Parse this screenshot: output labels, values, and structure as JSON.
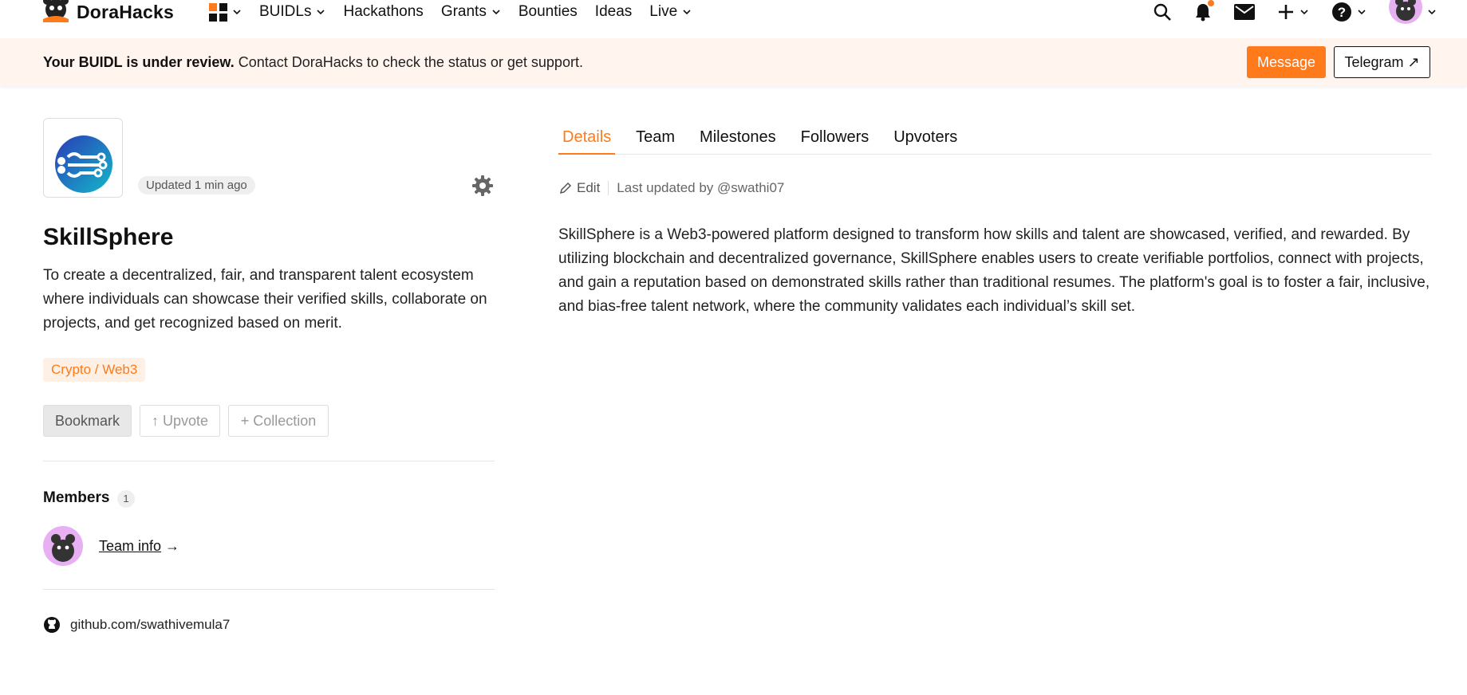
{
  "nav": {
    "brand": "DoraHacks",
    "items": [
      {
        "label": "BUIDLs",
        "dropdown": true
      },
      {
        "label": "Hackathons",
        "dropdown": false
      },
      {
        "label": "Grants",
        "dropdown": true
      },
      {
        "label": "Bounties",
        "dropdown": false
      },
      {
        "label": "Ideas",
        "dropdown": false
      },
      {
        "label": "Live",
        "dropdown": true
      }
    ],
    "right_icons": [
      "search-icon",
      "bell-icon",
      "mail-icon",
      "plus-icon",
      "help-icon",
      "avatar"
    ]
  },
  "banner": {
    "bold": "Your BUIDL is under review.",
    "text": " Contact DoraHacks to check the status or get support.",
    "message_label": "Message",
    "telegram_label": "Telegram ↗"
  },
  "project": {
    "updated": "Updated 1 min ago",
    "title": "SkillSphere",
    "tagline": "To create a decentralized, fair, and transparent talent ecosystem where individuals can showcase their verified skills, collaborate on projects, and get recognized based on merit.",
    "tag": "Crypto / Web3",
    "bookmark_label": "Bookmark",
    "upvote_label": "↑ Upvote",
    "collection_label": "+ Collection",
    "members_title": "Members",
    "members_count": "1",
    "team_link": "Team info",
    "team_arrow": " →",
    "github": "github.com/swathivemula7"
  },
  "tabs": [
    {
      "label": "Details",
      "active": true
    },
    {
      "label": "Team",
      "active": false
    },
    {
      "label": "Milestones",
      "active": false
    },
    {
      "label": "Followers",
      "active": false
    },
    {
      "label": "Upvoters",
      "active": false
    }
  ],
  "details": {
    "edit_label": "Edit",
    "last_updated": "Last updated by @swathi07",
    "description": "SkillSphere is a Web3-powered platform designed to transform how skills and talent are showcased, verified, and rewarded. By utilizing blockchain and decentralized governance, SkillSphere enables users to create verifiable portfolios, connect with projects, and gain a reputation based on demonstrated skills rather than traditional resumes. The platform's goal is to foster a fair, inclusive, and bias-free talent network, where the community validates each individual’s skill set."
  },
  "colors": {
    "accent": "#ff7a1a",
    "banner_bg": "#fff4ee",
    "avatar_bg": "#e6b0f2"
  }
}
